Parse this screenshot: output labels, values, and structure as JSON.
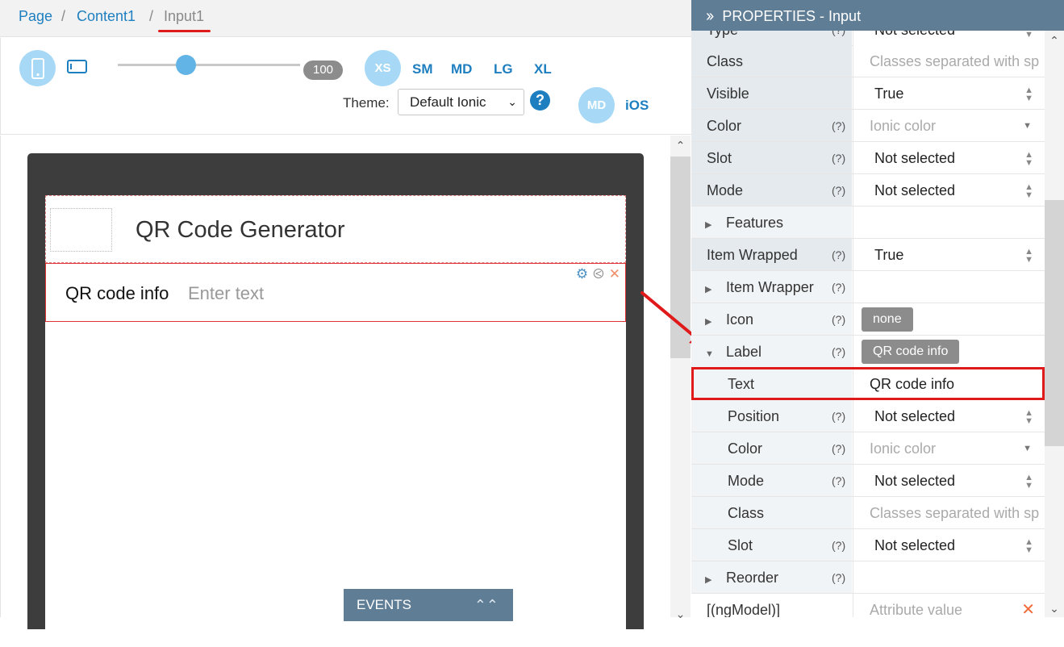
{
  "breadcrumb": {
    "page": "Page",
    "content": "Content1",
    "current": "Input1",
    "separator": "/"
  },
  "toolbar": {
    "slider_value": "100",
    "sizes": [
      "XS",
      "SM",
      "MD",
      "LG",
      "XL"
    ],
    "theme_label": "Theme:",
    "theme_value": "Default Ionic",
    "help": "?",
    "mode_md": "MD",
    "mode_ios": "iOS"
  },
  "canvas": {
    "header_title": "QR Code Generator",
    "input_label": "QR code info",
    "input_placeholder": "Enter text",
    "events_tab": "EVENTS"
  },
  "properties": {
    "title": "PROPERTIES - Input",
    "rows": [
      {
        "name": "Type",
        "value": "Not selected"
      },
      {
        "name": "Class",
        "value": "Classes separated with sp"
      },
      {
        "name": "Visible",
        "value": "True"
      },
      {
        "name": "Color",
        "value": "Ionic color"
      },
      {
        "name": "Slot",
        "value": "Not selected"
      },
      {
        "name": "Mode",
        "value": "Not selected"
      },
      {
        "name": "Features",
        "value": ""
      },
      {
        "name": "Item Wrapped",
        "value": "True"
      },
      {
        "name": "Item Wrapper",
        "value": ""
      },
      {
        "name": "Icon",
        "value": "none"
      },
      {
        "name": "Label",
        "value": "QR code info"
      },
      {
        "name": "Text",
        "value": "QR code info"
      },
      {
        "name": "Position",
        "value": "Not selected"
      },
      {
        "name": "Color",
        "value": "Ionic color"
      },
      {
        "name": "Mode",
        "value": "Not selected"
      },
      {
        "name": "Class",
        "value": "Classes separated with sp"
      },
      {
        "name": "Slot",
        "value": "Not selected"
      },
      {
        "name": "Reorder",
        "value": ""
      },
      {
        "name": "[(ngModel)]",
        "value": "Attribute value"
      }
    ],
    "help_mark": "(?)"
  },
  "colors": {
    "accent": "#1e7fc0",
    "panel_header": "#607d96",
    "highlight": "#e01a1a",
    "device_frame": "#3d3d3d"
  }
}
